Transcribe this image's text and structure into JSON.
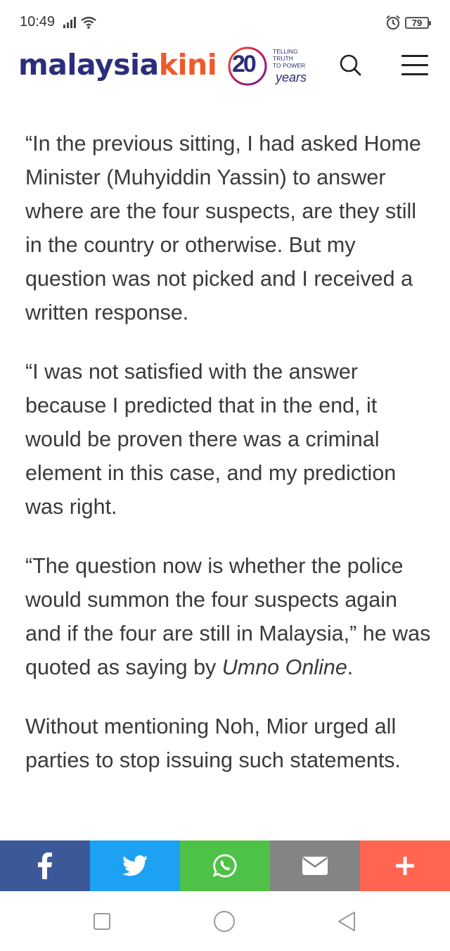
{
  "status_bar": {
    "time": "10:49",
    "battery_level": "79",
    "icons": [
      "signal-icon",
      "wifi-icon",
      "alarm-icon",
      "battery-icon"
    ]
  },
  "header": {
    "logo_part1": "malaysia",
    "logo_part2": "kini",
    "anniversary": {
      "number": "20",
      "tagline_line1": "TELLING",
      "tagline_line2": "TRUTH",
      "tagline_line3": "TO POWER",
      "years": "years"
    },
    "icons": [
      "search-icon",
      "hamburger-menu-icon"
    ]
  },
  "article": {
    "paragraphs": [
      "“In the previous sitting, I had asked Home Minister (Muhyiddin Yassin) to answer where are the four suspects, are they still in the country or otherwise. But my question was not picked and I received a written response.",
      "“I was not satisfied with the answer because I predicted that in the end, it would be proven there was a criminal element in this case, and my prediction was right.",
      "“The question now is whether the police would summon the four suspects again and if the four are still in Malaysia,” he was quoted as saying by ",
      "Without mentioning Noh, Mior urged all parties to stop issuing such statements."
    ],
    "source_italic": "Umno Online",
    "source_suffix": "."
  },
  "share_bar": {
    "buttons": [
      {
        "name": "facebook",
        "icon": "facebook-icon",
        "color": "#3b5998"
      },
      {
        "name": "twitter",
        "icon": "twitter-icon",
        "color": "#1da1f2"
      },
      {
        "name": "whatsapp",
        "icon": "whatsapp-icon",
        "color": "#4dc247"
      },
      {
        "name": "email",
        "icon": "email-icon",
        "color": "#848484"
      },
      {
        "name": "more",
        "icon": "plus-icon",
        "color": "#ff6550"
      }
    ]
  },
  "nav_bar": {
    "icons": [
      "recent-apps-icon",
      "home-icon",
      "back-icon"
    ]
  },
  "colors": {
    "brand_blue": "#2b2e7a",
    "brand_orange": "#f05a28",
    "text": "#3a3a3a"
  }
}
